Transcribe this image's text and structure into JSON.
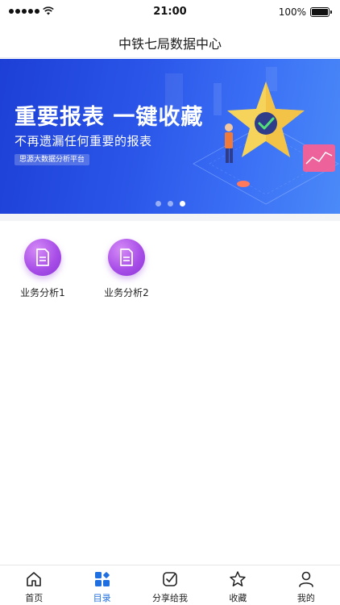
{
  "status_bar": {
    "time": "21:00",
    "battery": "100%"
  },
  "header": {
    "title": "中铁七局数据中心"
  },
  "banner": {
    "title": "重要报表 一键收藏",
    "subtitle": "不再遗漏任何重要的报表",
    "tag": "思源大数据分析平台",
    "slides": 3,
    "active_slide": 3
  },
  "catalog": {
    "items": [
      {
        "label": "业务分析1",
        "icon": "document-icon"
      },
      {
        "label": "业务分析2",
        "icon": "document-icon"
      }
    ]
  },
  "tabbar": {
    "items": [
      {
        "label": "首页",
        "icon": "home-icon"
      },
      {
        "label": "目录",
        "icon": "catalog-grid-icon",
        "active": true
      },
      {
        "label": "分享给我",
        "icon": "share-check-icon"
      },
      {
        "label": "收藏",
        "icon": "star-icon"
      },
      {
        "label": "我的",
        "icon": "user-icon"
      }
    ]
  },
  "colors": {
    "accent": "#1f6fe0",
    "banner_start": "#1d3fd6",
    "banner_end": "#4b8af8",
    "icon_purple": "#a94fe8"
  }
}
